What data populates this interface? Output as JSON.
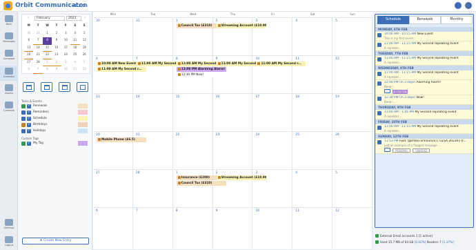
{
  "app": {
    "title": "Orbit Communicator",
    "version": "v1.2.16"
  },
  "nav": [
    {
      "label": "Back"
    },
    {
      "label": "Messages"
    },
    {
      "label": "Compose"
    },
    {
      "label": "Calendar"
    },
    {
      "label": "Assets"
    },
    {
      "label": "Contacts"
    },
    {
      "label": "Settings"
    },
    {
      "label": "Logout"
    }
  ],
  "minical": {
    "month": "February",
    "year": "2023",
    "dow": [
      "M",
      "T",
      "W",
      "T",
      "F",
      "S",
      "S"
    ],
    "weeks": [
      [
        "30",
        "31",
        "1",
        "2",
        "3",
        "4",
        "5"
      ],
      [
        "6",
        "7",
        "8",
        "9",
        "10",
        "11",
        "12"
      ],
      [
        "13",
        "14",
        "15",
        "16",
        "17",
        "18",
        "19"
      ],
      [
        "20",
        "21",
        "22",
        "23",
        "24",
        "25",
        "26"
      ],
      [
        "27",
        "28",
        "1",
        "2",
        "3",
        "4",
        "5"
      ],
      [
        "6",
        "7",
        "8",
        "9",
        "10",
        "11",
        "12"
      ]
    ]
  },
  "filters": {
    "tasks_title": "Tasks & Events",
    "items": [
      {
        "label": "Renewals",
        "color": "#f5dfbf"
      },
      {
        "label": "Reminders",
        "color": "#f7c9cf"
      },
      {
        "label": "Schedule",
        "color": "#f8f3b5"
      },
      {
        "label": "Birthdays",
        "color": "#f2d3b8"
      },
      {
        "label": "Holidays",
        "color": "#cfe3f7"
      }
    ],
    "tags_title": "Custom Tags",
    "tags": [
      {
        "label": "My Tag",
        "color": "#c9a6ee"
      }
    ]
  },
  "create_label": "Create New Entry",
  "calendar": {
    "days": [
      "Mon",
      "Tue",
      "Wed",
      "Thu",
      "Fri",
      "Sat",
      "Sun"
    ],
    "weeks": [
      {
        "nums": [
          "30",
          "31",
          "1",
          "2",
          "3",
          "4",
          "5"
        ]
      },
      {
        "nums": [
          "6",
          "7",
          "8",
          "9",
          "10",
          "11",
          "12"
        ]
      },
      {
        "nums": [
          "13",
          "14",
          "15",
          "16",
          "17",
          "18",
          "19"
        ]
      },
      {
        "nums": [
          "20",
          "21",
          "22",
          "23",
          "24",
          "25",
          "26"
        ]
      },
      {
        "nums": [
          "27",
          "28",
          "1",
          "2",
          "3",
          "4",
          "5"
        ]
      },
      {
        "nums": [
          "6",
          "7",
          "8",
          "9",
          "10",
          "11",
          "12"
        ]
      }
    ],
    "events": {
      "w0d2": "Council Tax (£310)",
      "w0d3": "Streaming Account (£10.99)",
      "w1d0a": "10:00 AM New Event",
      "w1d0b": "11:00 AM My Second r...",
      "w1d1": "11:00 AM My Second r...",
      "w1d2a": "11:00 AM My Second r...",
      "w1d2b": "12:00 PM Alarming Alarm!",
      "w1d2c": "12:30 PM Now!",
      "w1d3": "11:00 AM My Second rep...",
      "w1d4": "11:00 AM My Second r...",
      "w3d0": "Mobile Phone (£6.5)",
      "w4d2a": "Insurance (£200)",
      "w4d2b": "Council Tax (£310)",
      "w4d3": "Streaming Account (£10.99)"
    }
  },
  "schedule": {
    "tabs": [
      "Schedule",
      "Renewals",
      "Monthly"
    ],
    "groups": [
      {
        "day": "MONDAY, 6TH FEB",
        "items": [
          {
            "time": "10:00 AM - 10:15 AM",
            "title": "New Event",
            "sub": "This is my first event..."
          },
          {
            "time": "11:00 AM - 11:15 AM",
            "title": "My Second repeating event",
            "sub": "A repeater..."
          }
        ]
      },
      {
        "day": "TUESDAY, 7TH FEB",
        "items": [
          {
            "time": "11:00 AM - 11:15 AM",
            "title": "My Second repeating event",
            "sub": "A repeater..."
          }
        ]
      },
      {
        "day": "WEDNESDAY, 8TH FEB",
        "items": [
          {
            "time": "11:00 AM - 11:15 AM",
            "title": "My Second repeating event",
            "sub": "A repeater..."
          },
          {
            "time": "12:00 PM (in 3 days)",
            "title": "Alarming Alarm!",
            "sub": "Beep!...",
            "chip": "My Tag"
          },
          {
            "time": "12:30 PM (in 3 days)",
            "title": "Now!",
            "sub": "Beep!..."
          }
        ]
      },
      {
        "day": "THURSDAY, 9TH FEB",
        "items": [
          {
            "time": "11:00 AM - 1:45 PM",
            "title": "My Second repeating event",
            "sub": "A repeater..."
          }
        ]
      },
      {
        "day": "FRIDAY, 10TH FEB",
        "items": [
          {
            "time": "11:00 AM - 11:15 AM",
            "title": "My Second repeating event",
            "sub": "A repeater..."
          }
        ]
      },
      {
        "day": "SUNDAY, 12TH FEB",
        "items": [
          {
            "time": "11:53 PM",
            "title": "Fwd: [gentoo-announce] [ GLSA 202301-0...",
            "sub": "Just an example of a flagged message ...",
            "chips": [
              "PENDING",
              "UNREAD"
            ]
          }
        ]
      }
    ],
    "footer": {
      "accounts": "External Email accounts 1 [1 active]",
      "used": "Used 15.7 MB of 64 GB",
      "used_pct": "[0.02%]",
      "readers": "Readers 7",
      "readers_pct": "[1.37%]"
    }
  }
}
